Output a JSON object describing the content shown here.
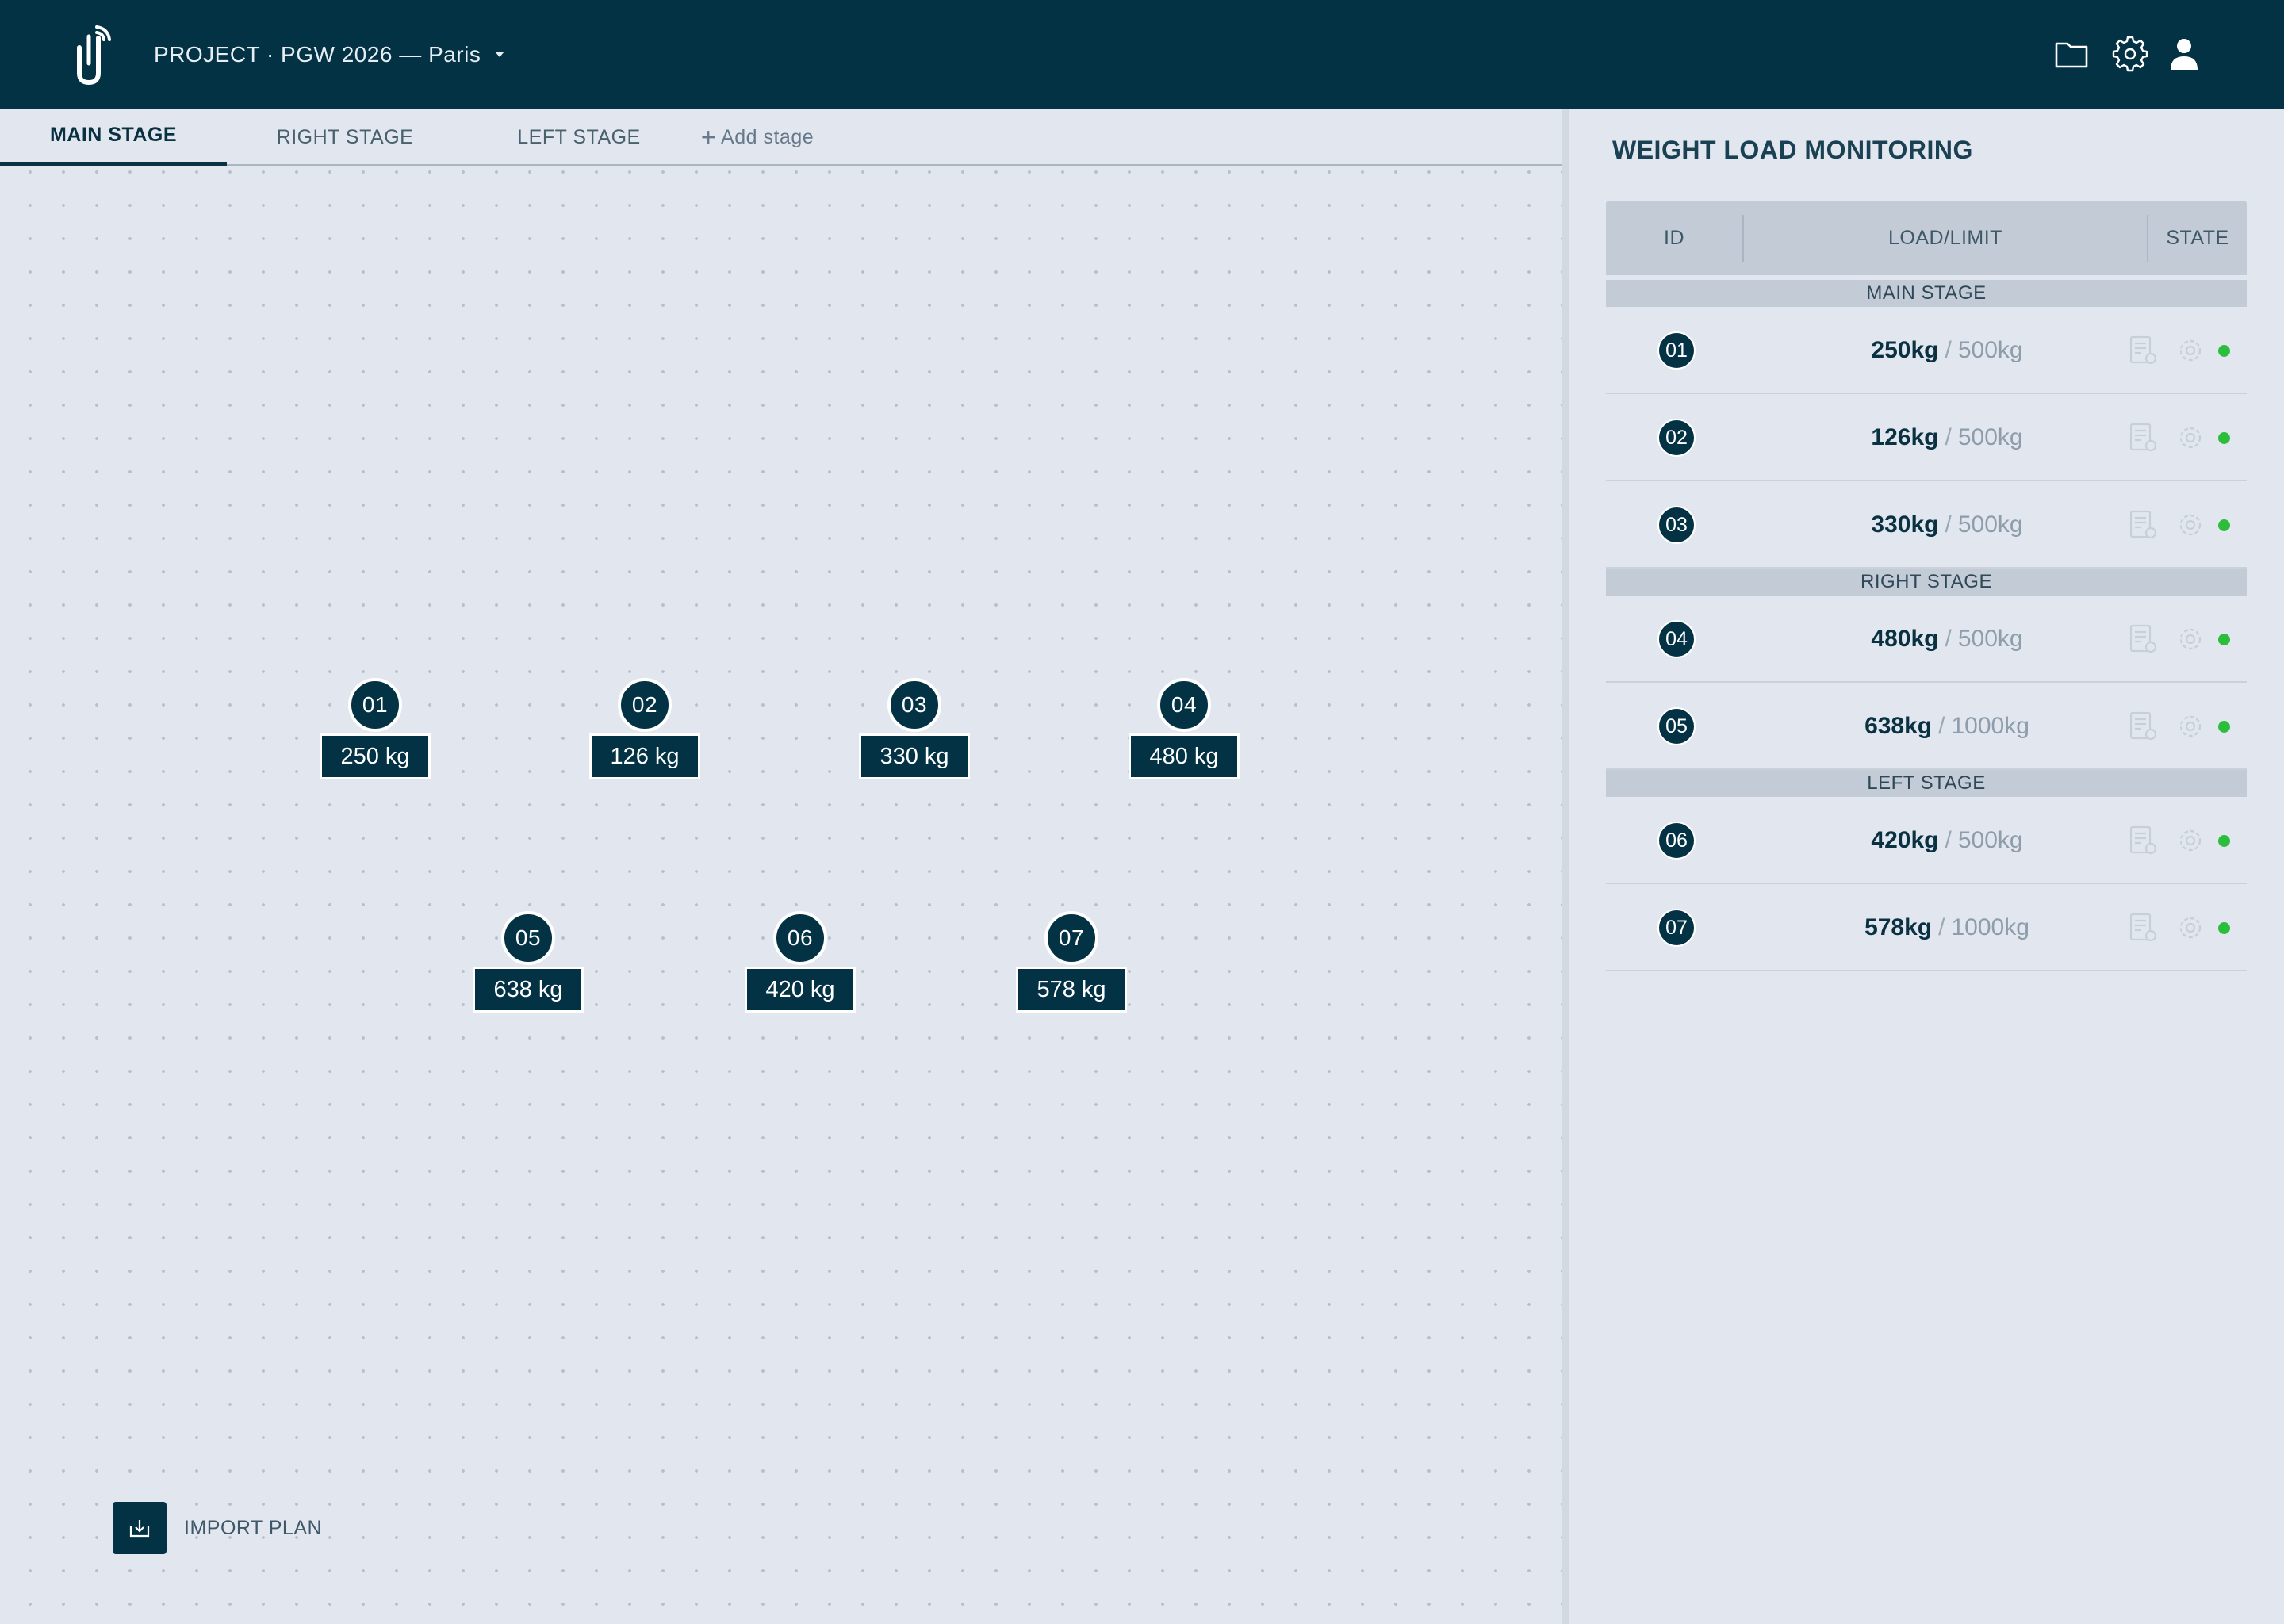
{
  "header": {
    "project_label": "PROJECT · PGW 2026 — Paris",
    "icons": [
      "folder-icon",
      "gear-icon",
      "user-icon"
    ]
  },
  "tabs": [
    {
      "label": "MAIN STAGE",
      "active": true
    },
    {
      "label": "RIGHT STAGE",
      "active": false
    },
    {
      "label": "LEFT STAGE",
      "active": false
    }
  ],
  "add_stage": {
    "plus": "+",
    "label": "Add stage"
  },
  "canvas": {
    "sensors": [
      {
        "id": "01",
        "weight": "250 kg"
      },
      {
        "id": "02",
        "weight": "126 kg"
      },
      {
        "id": "03",
        "weight": "330 kg"
      },
      {
        "id": "04",
        "weight": "480 kg"
      },
      {
        "id": "05",
        "weight": "638 kg"
      },
      {
        "id": "06",
        "weight": "420 kg"
      },
      {
        "id": "07",
        "weight": "578 kg"
      }
    ]
  },
  "import": {
    "label": "IMPORT PLAN",
    "icon": "import-icon"
  },
  "panel": {
    "title": "WEIGHT LOAD MONITORING",
    "columns": [
      "ID",
      "LOAD/LIMIT",
      "STATE"
    ],
    "sections": [
      {
        "name": "MAIN STAGE"
      },
      {
        "name": "RIGHT STAGE"
      },
      {
        "name": "LEFT STAGE"
      }
    ],
    "rows": [
      {
        "id": "01",
        "load": "250kg",
        "slash": "/",
        "limit": "500kg",
        "state": "ok"
      },
      {
        "id": "02",
        "load": "126kg",
        "slash": "/",
        "limit": "500kg",
        "state": "ok"
      },
      {
        "id": "03",
        "load": "330kg",
        "slash": "/",
        "limit": "500kg",
        "state": "ok"
      },
      {
        "id": "04",
        "load": "480kg",
        "slash": "/",
        "limit": "500kg",
        "state": "ok"
      },
      {
        "id": "05",
        "load": "638kg",
        "slash": "/",
        "limit": "1000kg",
        "state": "ok"
      },
      {
        "id": "06",
        "load": "420kg",
        "slash": "/",
        "limit": "500kg",
        "state": "ok"
      },
      {
        "id": "07",
        "load": "578kg",
        "slash": "/",
        "limit": "1000kg",
        "state": "ok"
      }
    ],
    "row_icons": [
      "report-icon",
      "settings-icon",
      "status-dot-icon"
    ],
    "colors": {
      "ok": "#2dbd3c",
      "brand": "#033244"
    }
  }
}
